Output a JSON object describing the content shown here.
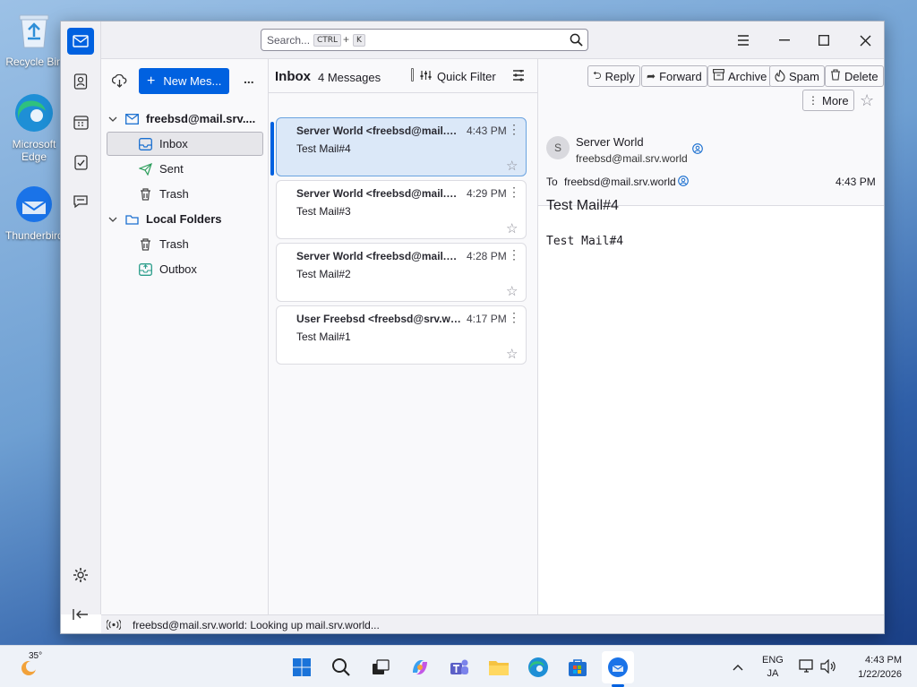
{
  "desktop": {
    "icons": [
      {
        "label": "Recycle Bin",
        "icon": "recycle-bin-icon"
      },
      {
        "label": "Microsoft Edge",
        "icon": "edge-icon"
      },
      {
        "label": "Thunderbird",
        "icon": "thunderbird-icon"
      }
    ]
  },
  "search": {
    "placeholder": "Search...",
    "key1": "CTRL",
    "plus": "+",
    "key2": "K"
  },
  "folders": {
    "new_message": "New Mes...",
    "more": "...",
    "account": "freebsd@mail.srv....",
    "items": [
      {
        "label": "Inbox",
        "icon": "inbox-icon"
      },
      {
        "label": "Sent",
        "icon": "sent-icon"
      },
      {
        "label": "Trash",
        "icon": "trash-icon"
      }
    ],
    "local_title": "Local Folders",
    "local_items": [
      {
        "label": "Trash",
        "icon": "trash-icon"
      },
      {
        "label": "Outbox",
        "icon": "outbox-icon"
      }
    ]
  },
  "list": {
    "folder_name": "Inbox",
    "count": "4 Messages",
    "quick_filter": "Quick Filter",
    "messages": [
      {
        "from": "Server World <freebsd@mail.srv.world>",
        "time": "4:43 PM",
        "subject": "Test Mail#4",
        "selected": true
      },
      {
        "from": "Server World <freebsd@mail.srv.world>",
        "time": "4:29 PM",
        "subject": "Test Mail#3"
      },
      {
        "from": "Server World <freebsd@mail.srv.world>",
        "time": "4:28 PM",
        "subject": "Test Mail#2"
      },
      {
        "from": "User Freebsd <freebsd@srv.world>",
        "time": "4:17 PM",
        "subject": "Test Mail#1"
      }
    ]
  },
  "reader": {
    "toolbar": {
      "reply": "Reply",
      "forward": "Forward",
      "archive": "Archive",
      "spam": "Spam",
      "delete": "Delete",
      "more": "More"
    },
    "avatar_letter": "S",
    "sender_name": "Server World",
    "sender_email": "freebsd@mail.srv.world",
    "to_label": "To",
    "to_email": "freebsd@mail.srv.world",
    "time": "4:43 PM",
    "subject": "Test Mail#4",
    "body": "Test Mail#4"
  },
  "status": {
    "text": "freebsd@mail.srv.world: Looking up mail.srv.world..."
  },
  "taskbar": {
    "weather_temp": "35°",
    "lang1": "ENG",
    "lang2": "JA",
    "clock_time": "4:43 PM",
    "clock_date": "1/22/2026"
  },
  "colors": {
    "accent": "#0061e0",
    "selected_card": "#dbe8f8",
    "selected_border": "#6aa3e0"
  }
}
